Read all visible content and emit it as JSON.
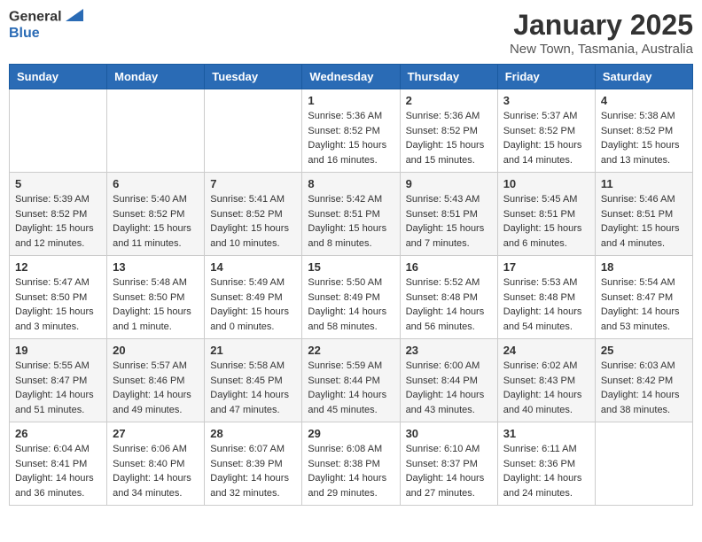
{
  "header": {
    "logo_general": "General",
    "logo_blue": "Blue",
    "month": "January 2025",
    "location": "New Town, Tasmania, Australia"
  },
  "days_of_week": [
    "Sunday",
    "Monday",
    "Tuesday",
    "Wednesday",
    "Thursday",
    "Friday",
    "Saturday"
  ],
  "weeks": [
    [
      {
        "day": "",
        "sunrise": "",
        "sunset": "",
        "daylight": ""
      },
      {
        "day": "",
        "sunrise": "",
        "sunset": "",
        "daylight": ""
      },
      {
        "day": "",
        "sunrise": "",
        "sunset": "",
        "daylight": ""
      },
      {
        "day": "1",
        "sunrise": "Sunrise: 5:36 AM",
        "sunset": "Sunset: 8:52 PM",
        "daylight": "Daylight: 15 hours and 16 minutes."
      },
      {
        "day": "2",
        "sunrise": "Sunrise: 5:36 AM",
        "sunset": "Sunset: 8:52 PM",
        "daylight": "Daylight: 15 hours and 15 minutes."
      },
      {
        "day": "3",
        "sunrise": "Sunrise: 5:37 AM",
        "sunset": "Sunset: 8:52 PM",
        "daylight": "Daylight: 15 hours and 14 minutes."
      },
      {
        "day": "4",
        "sunrise": "Sunrise: 5:38 AM",
        "sunset": "Sunset: 8:52 PM",
        "daylight": "Daylight: 15 hours and 13 minutes."
      }
    ],
    [
      {
        "day": "5",
        "sunrise": "Sunrise: 5:39 AM",
        "sunset": "Sunset: 8:52 PM",
        "daylight": "Daylight: 15 hours and 12 minutes."
      },
      {
        "day": "6",
        "sunrise": "Sunrise: 5:40 AM",
        "sunset": "Sunset: 8:52 PM",
        "daylight": "Daylight: 15 hours and 11 minutes."
      },
      {
        "day": "7",
        "sunrise": "Sunrise: 5:41 AM",
        "sunset": "Sunset: 8:52 PM",
        "daylight": "Daylight: 15 hours and 10 minutes."
      },
      {
        "day": "8",
        "sunrise": "Sunrise: 5:42 AM",
        "sunset": "Sunset: 8:51 PM",
        "daylight": "Daylight: 15 hours and 8 minutes."
      },
      {
        "day": "9",
        "sunrise": "Sunrise: 5:43 AM",
        "sunset": "Sunset: 8:51 PM",
        "daylight": "Daylight: 15 hours and 7 minutes."
      },
      {
        "day": "10",
        "sunrise": "Sunrise: 5:45 AM",
        "sunset": "Sunset: 8:51 PM",
        "daylight": "Daylight: 15 hours and 6 minutes."
      },
      {
        "day": "11",
        "sunrise": "Sunrise: 5:46 AM",
        "sunset": "Sunset: 8:51 PM",
        "daylight": "Daylight: 15 hours and 4 minutes."
      }
    ],
    [
      {
        "day": "12",
        "sunrise": "Sunrise: 5:47 AM",
        "sunset": "Sunset: 8:50 PM",
        "daylight": "Daylight: 15 hours and 3 minutes."
      },
      {
        "day": "13",
        "sunrise": "Sunrise: 5:48 AM",
        "sunset": "Sunset: 8:50 PM",
        "daylight": "Daylight: 15 hours and 1 minute."
      },
      {
        "day": "14",
        "sunrise": "Sunrise: 5:49 AM",
        "sunset": "Sunset: 8:49 PM",
        "daylight": "Daylight: 15 hours and 0 minutes."
      },
      {
        "day": "15",
        "sunrise": "Sunrise: 5:50 AM",
        "sunset": "Sunset: 8:49 PM",
        "daylight": "Daylight: 14 hours and 58 minutes."
      },
      {
        "day": "16",
        "sunrise": "Sunrise: 5:52 AM",
        "sunset": "Sunset: 8:48 PM",
        "daylight": "Daylight: 14 hours and 56 minutes."
      },
      {
        "day": "17",
        "sunrise": "Sunrise: 5:53 AM",
        "sunset": "Sunset: 8:48 PM",
        "daylight": "Daylight: 14 hours and 54 minutes."
      },
      {
        "day": "18",
        "sunrise": "Sunrise: 5:54 AM",
        "sunset": "Sunset: 8:47 PM",
        "daylight": "Daylight: 14 hours and 53 minutes."
      }
    ],
    [
      {
        "day": "19",
        "sunrise": "Sunrise: 5:55 AM",
        "sunset": "Sunset: 8:47 PM",
        "daylight": "Daylight: 14 hours and 51 minutes."
      },
      {
        "day": "20",
        "sunrise": "Sunrise: 5:57 AM",
        "sunset": "Sunset: 8:46 PM",
        "daylight": "Daylight: 14 hours and 49 minutes."
      },
      {
        "day": "21",
        "sunrise": "Sunrise: 5:58 AM",
        "sunset": "Sunset: 8:45 PM",
        "daylight": "Daylight: 14 hours and 47 minutes."
      },
      {
        "day": "22",
        "sunrise": "Sunrise: 5:59 AM",
        "sunset": "Sunset: 8:44 PM",
        "daylight": "Daylight: 14 hours and 45 minutes."
      },
      {
        "day": "23",
        "sunrise": "Sunrise: 6:00 AM",
        "sunset": "Sunset: 8:44 PM",
        "daylight": "Daylight: 14 hours and 43 minutes."
      },
      {
        "day": "24",
        "sunrise": "Sunrise: 6:02 AM",
        "sunset": "Sunset: 8:43 PM",
        "daylight": "Daylight: 14 hours and 40 minutes."
      },
      {
        "day": "25",
        "sunrise": "Sunrise: 6:03 AM",
        "sunset": "Sunset: 8:42 PM",
        "daylight": "Daylight: 14 hours and 38 minutes."
      }
    ],
    [
      {
        "day": "26",
        "sunrise": "Sunrise: 6:04 AM",
        "sunset": "Sunset: 8:41 PM",
        "daylight": "Daylight: 14 hours and 36 minutes."
      },
      {
        "day": "27",
        "sunrise": "Sunrise: 6:06 AM",
        "sunset": "Sunset: 8:40 PM",
        "daylight": "Daylight: 14 hours and 34 minutes."
      },
      {
        "day": "28",
        "sunrise": "Sunrise: 6:07 AM",
        "sunset": "Sunset: 8:39 PM",
        "daylight": "Daylight: 14 hours and 32 minutes."
      },
      {
        "day": "29",
        "sunrise": "Sunrise: 6:08 AM",
        "sunset": "Sunset: 8:38 PM",
        "daylight": "Daylight: 14 hours and 29 minutes."
      },
      {
        "day": "30",
        "sunrise": "Sunrise: 6:10 AM",
        "sunset": "Sunset: 8:37 PM",
        "daylight": "Daylight: 14 hours and 27 minutes."
      },
      {
        "day": "31",
        "sunrise": "Sunrise: 6:11 AM",
        "sunset": "Sunset: 8:36 PM",
        "daylight": "Daylight: 14 hours and 24 minutes."
      },
      {
        "day": "",
        "sunrise": "",
        "sunset": "",
        "daylight": ""
      }
    ]
  ]
}
